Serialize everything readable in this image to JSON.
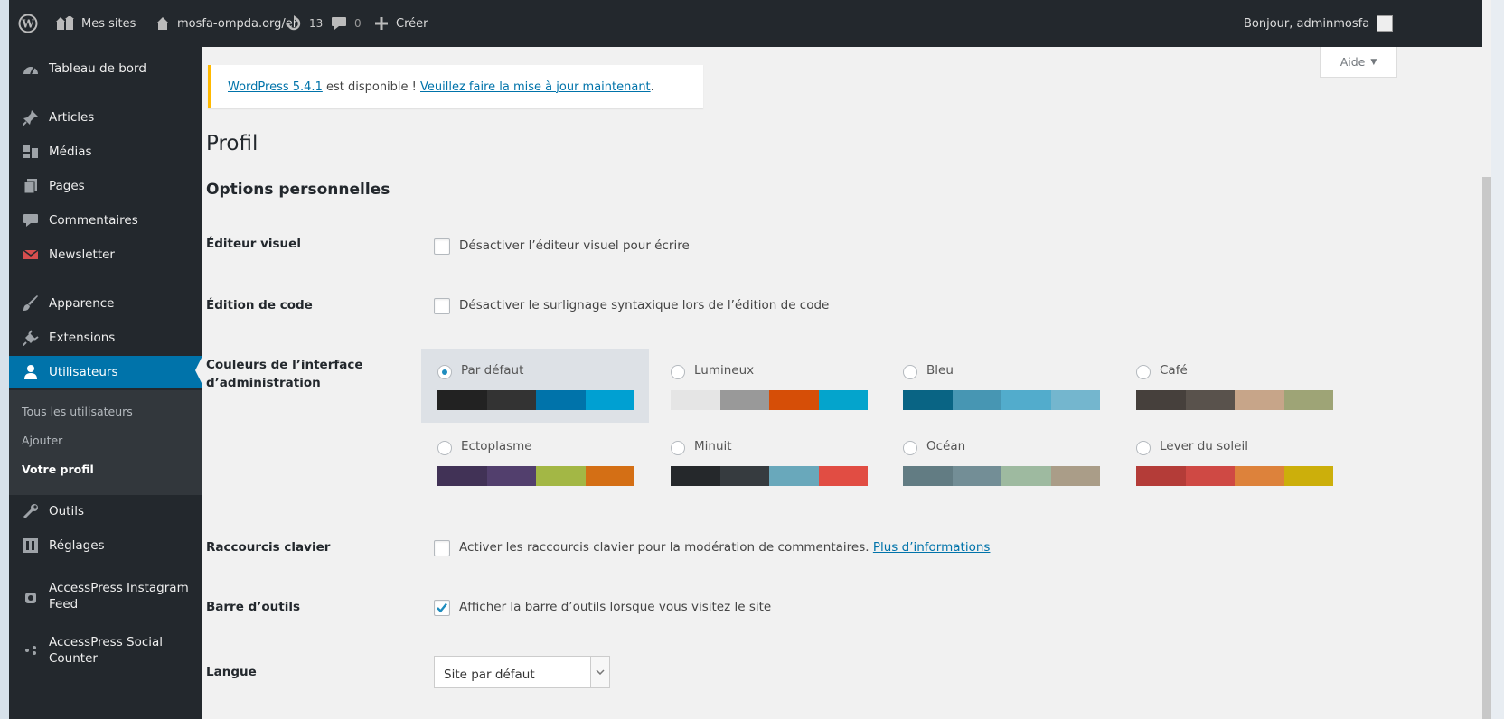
{
  "adminbar": {
    "my_sites": "Mes sites",
    "site_url": "mosfa-ompda.org/en",
    "updates_count": "13",
    "comments_count": "0",
    "create_label": "Créer",
    "greeting": "Bonjour, adminmosfa"
  },
  "sidebar": {
    "items": [
      {
        "label": "Tableau de bord",
        "icon": "dashboard-icon"
      },
      {
        "label": "Articles",
        "icon": "pin-icon"
      },
      {
        "label": "Médias",
        "icon": "media-icon"
      },
      {
        "label": "Pages",
        "icon": "pages-icon"
      },
      {
        "label": "Commentaires",
        "icon": "comment-icon"
      },
      {
        "label": "Newsletter",
        "icon": "newsletter-icon"
      },
      {
        "label": "Apparence",
        "icon": "brush-icon"
      },
      {
        "label": "Extensions",
        "icon": "plugin-icon"
      },
      {
        "label": "Utilisateurs",
        "icon": "user-icon"
      },
      {
        "label": "Outils",
        "icon": "wrench-icon"
      },
      {
        "label": "Réglages",
        "icon": "settings-icon"
      },
      {
        "label": "AccessPress Instagram Feed",
        "icon": "instagram-icon"
      },
      {
        "label": "AccessPress Social Counter",
        "icon": "social-icon"
      }
    ],
    "submenu": [
      "Tous les utilisateurs",
      "Ajouter",
      "Votre profil"
    ]
  },
  "notice": {
    "version_link": "WordPress 5.4.1",
    "middle_text": " est disponible ! ",
    "update_link": "Veuillez faire la mise à jour maintenant",
    "end_text": "."
  },
  "help_label": "Aide",
  "page_title": "Profil",
  "section_title": "Options personnelles",
  "rows": {
    "visual_editor": {
      "label": "Éditeur visuel",
      "text": "Désactiver l’éditeur visuel pour écrire"
    },
    "code_editing": {
      "label": "Édition de code",
      "text": "Désactiver le surlignage syntaxique lors de l’édition de code"
    },
    "colors": {
      "label": "Couleurs de l’interface d’administration"
    },
    "shortcuts": {
      "label": "Raccourcis clavier",
      "text": "Activer les raccourcis clavier pour la modération de commentaires.",
      "link": "Plus d’informations"
    },
    "toolbar": {
      "label": "Barre d’outils",
      "text": "Afficher la barre d’outils lorsque vous visitez le site",
      "checked": true
    },
    "language": {
      "label": "Langue",
      "value": "Site par défaut"
    }
  },
  "schemes": [
    {
      "name": "Par défaut",
      "selected": true,
      "colors": [
        "#222222",
        "#333333",
        "#0073aa",
        "#00a0d2"
      ]
    },
    {
      "name": "Lumineux",
      "colors": [
        "#e5e5e5",
        "#999999",
        "#d64e07",
        "#04a4cc"
      ]
    },
    {
      "name": "Bleu",
      "colors": [
        "#096484",
        "#4796b3",
        "#52accc",
        "#74b6ce"
      ]
    },
    {
      "name": "Café",
      "colors": [
        "#46403c",
        "#59524c",
        "#c7a589",
        "#9ea476"
      ]
    },
    {
      "name": "Ectoplasme",
      "colors": [
        "#413256",
        "#523f6d",
        "#a3b745",
        "#d46f15"
      ]
    },
    {
      "name": "Minuit",
      "colors": [
        "#25282b",
        "#363b3f",
        "#69a8bb",
        "#e14d43"
      ]
    },
    {
      "name": "Océan",
      "colors": [
        "#627c83",
        "#738e96",
        "#9ebaa0",
        "#aa9d88"
      ]
    },
    {
      "name": "Lever du soleil",
      "colors": [
        "#b43c38",
        "#cf4944",
        "#dd823b",
        "#ccaf0b"
      ]
    }
  ],
  "colors": {
    "accent": "#0073aa",
    "adminbar_bg": "#23282d",
    "notice_border": "#ffb900"
  }
}
